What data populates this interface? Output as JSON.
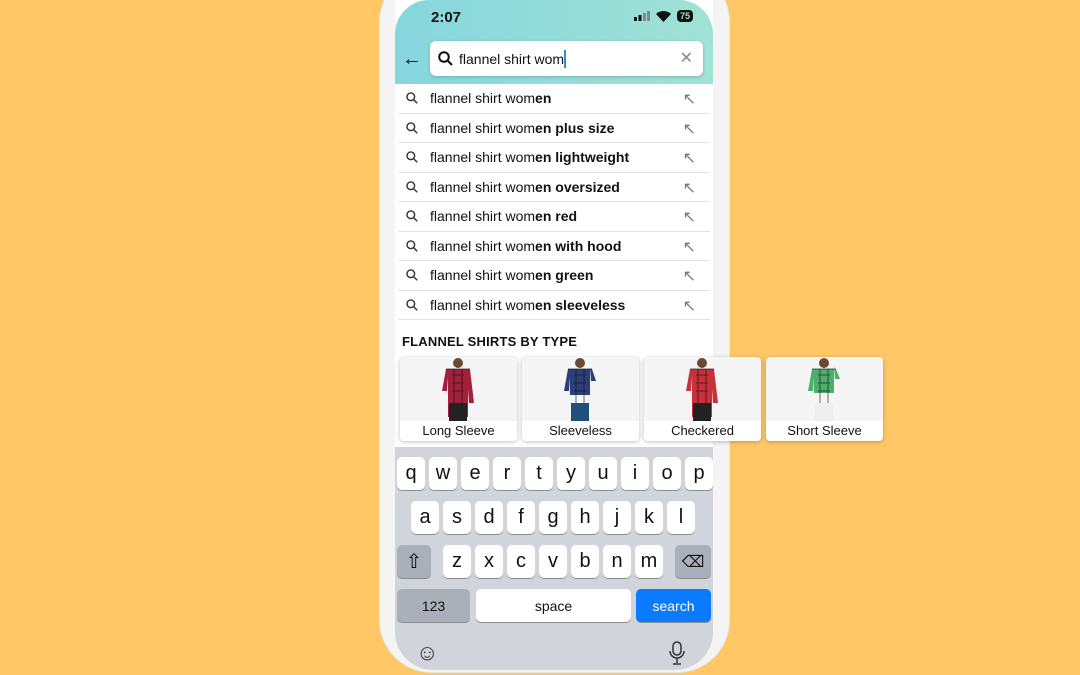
{
  "status_bar": {
    "time": "2:07",
    "battery": "75"
  },
  "search": {
    "query": "flannel shirt wom",
    "back_icon": "arrow-left-icon",
    "clear_icon": "close-icon"
  },
  "suggestions": [
    {
      "prefix": "flannel shirt wom",
      "completion": "en"
    },
    {
      "prefix": "flannel shirt wom",
      "completion": "en plus size"
    },
    {
      "prefix": "flannel shirt wom",
      "completion": "en lightweight"
    },
    {
      "prefix": "flannel shirt wom",
      "completion": "en oversized"
    },
    {
      "prefix": "flannel shirt wom",
      "completion": "en red"
    },
    {
      "prefix": "flannel shirt wom",
      "completion": "en with hood"
    },
    {
      "prefix": "flannel shirt wom",
      "completion": "en green"
    },
    {
      "prefix": "flannel shirt wom",
      "completion": "en sleeveless"
    }
  ],
  "types": {
    "heading": "FLANNEL SHIRTS BY TYPE",
    "items": [
      {
        "label": "Long Sleeve",
        "color": "#a3203a"
      },
      {
        "label": "Sleeveless",
        "color": "#2c3e7a"
      },
      {
        "label": "Checkered",
        "color": "#c8313a"
      },
      {
        "label": "Short Sleeve",
        "color": "#4caf6e"
      }
    ]
  },
  "keyboard": {
    "rows": [
      [
        "q",
        "w",
        "e",
        "r",
        "t",
        "y",
        "u",
        "i",
        "o",
        "p"
      ],
      [
        "a",
        "s",
        "d",
        "f",
        "g",
        "h",
        "j",
        "k",
        "l"
      ],
      [
        "z",
        "x",
        "c",
        "v",
        "b",
        "n",
        "m"
      ]
    ],
    "numbers": "123",
    "space": "space",
    "search": "search",
    "search_color": "#0a7aff"
  }
}
